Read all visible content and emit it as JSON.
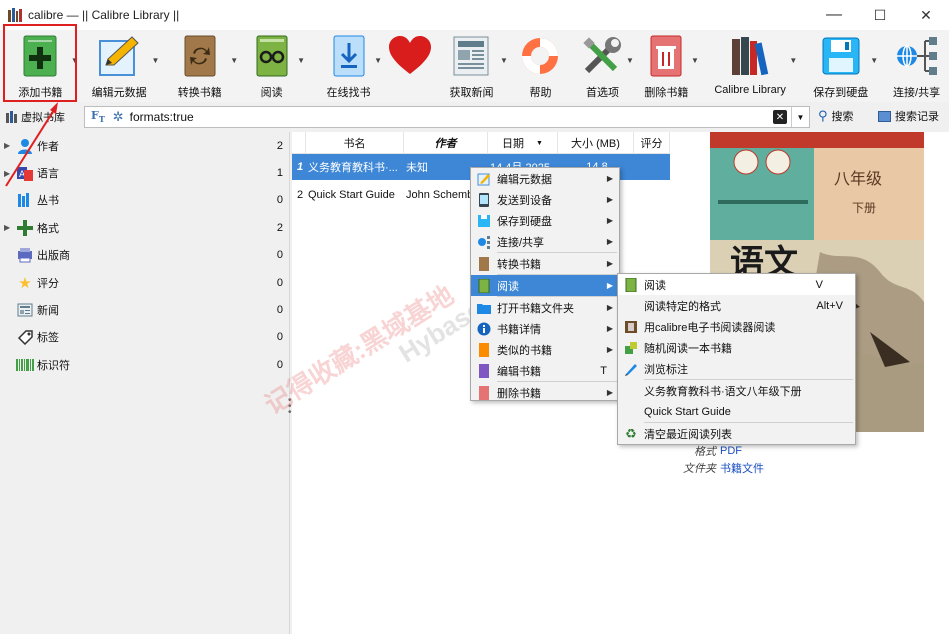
{
  "window": {
    "title": "calibre — || Calibre Library ||",
    "min": "—",
    "max": "☐",
    "close": "✕"
  },
  "toolbar": {
    "items": [
      {
        "label": "添加书籍",
        "icon": "add-book-icon"
      },
      {
        "label": "编辑元数据",
        "icon": "edit-metadata-icon"
      },
      {
        "label": "转换书籍",
        "icon": "convert-book-icon"
      },
      {
        "label": "阅读",
        "icon": "read-book-icon"
      },
      {
        "label": "在线找书",
        "icon": "find-online-icon"
      },
      {
        "label": "",
        "icon": "heart-icon"
      },
      {
        "label": "获取新闻",
        "icon": "fetch-news-icon"
      },
      {
        "label": "帮助",
        "icon": "help-lifebuoy-icon"
      },
      {
        "label": "首选项",
        "icon": "preferences-tools-icon"
      },
      {
        "label": "删除书籍",
        "icon": "delete-book-icon"
      },
      {
        "label": "Calibre Library",
        "icon": "library-icon"
      },
      {
        "label": "保存到硬盘",
        "icon": "save-disk-icon"
      },
      {
        "label": "连接/共享",
        "icon": "connect-share-icon"
      }
    ]
  },
  "search": {
    "virtual_library": "虚拟书库",
    "query": "formats:true",
    "search_label": "搜索",
    "history_label": "搜索记录"
  },
  "tag_browser": {
    "items": [
      {
        "label": "作者",
        "count": "2",
        "icon": "authors-icon"
      },
      {
        "label": "语言",
        "count": "1",
        "icon": "languages-icon"
      },
      {
        "label": "丛书",
        "count": "0",
        "icon": "series-icon"
      },
      {
        "label": "格式",
        "count": "2",
        "icon": "formats-icon"
      },
      {
        "label": "出版商",
        "count": "0",
        "icon": "publisher-icon"
      },
      {
        "label": "评分",
        "count": "0",
        "icon": "rating-star-icon"
      },
      {
        "label": "新闻",
        "count": "0",
        "icon": "news-icon"
      },
      {
        "label": "标签",
        "count": "0",
        "icon": "tags-icon"
      },
      {
        "label": "标识符",
        "count": "0",
        "icon": "identifiers-icon"
      }
    ]
  },
  "book_list": {
    "columns": [
      "书名",
      "作者",
      "日期",
      "大小 (MB)",
      "评分"
    ],
    "rows": [
      {
        "num": "1",
        "title": "义务教育教科书·...",
        "author": "未知",
        "date": "14 4月 2025",
        "size": "14.8"
      },
      {
        "num": "2",
        "title": "Quick Start Guide",
        "author": "John Schember",
        "date": "",
        "size": ""
      }
    ]
  },
  "context_menu": {
    "items": [
      {
        "label": "编辑元数据",
        "icon": "edit-metadata-icon",
        "submenu": true
      },
      {
        "label": "发送到设备",
        "icon": "send-device-icon",
        "submenu": true
      },
      {
        "label": "保存到硬盘",
        "icon": "save-disk-icon",
        "submenu": true
      },
      {
        "label": "连接/共享",
        "icon": "connect-share-icon",
        "submenu": true
      },
      {
        "label": "转换书籍",
        "icon": "convert-book-icon",
        "submenu": true
      },
      {
        "label": "阅读",
        "icon": "read-book-icon",
        "submenu": true
      },
      {
        "label": "打开书籍文件夹",
        "icon": "folder-icon",
        "submenu": true
      },
      {
        "label": "书籍详情",
        "icon": "info-icon",
        "submenu": true
      },
      {
        "label": "类似的书籍",
        "icon": "similar-books-icon",
        "submenu": true
      },
      {
        "label": "编辑书籍",
        "icon": "edit-book-icon",
        "shortcut": "T"
      },
      {
        "label": "删除书籍",
        "icon": "delete-book-icon",
        "submenu": true
      }
    ]
  },
  "read_submenu": {
    "items": [
      {
        "label": "阅读",
        "shortcut": "V",
        "icon": "read-book-icon"
      },
      {
        "label": "阅读特定的格式",
        "shortcut": "Alt+V",
        "icon": ""
      },
      {
        "label": "用calibre电子书阅读器阅读",
        "shortcut": "",
        "icon": "ebook-viewer-icon"
      },
      {
        "label": "随机阅读一本书籍",
        "shortcut": "",
        "icon": "random-icon"
      },
      {
        "label": "浏览标注",
        "shortcut": "",
        "icon": "annotations-icon"
      },
      {
        "label": "义务教育教科书·语文八年级下册",
        "shortcut": "",
        "icon": ""
      },
      {
        "label": "Quick Start Guide",
        "shortcut": "",
        "icon": ""
      },
      {
        "label": "清空最近阅读列表",
        "shortcut": "",
        "icon": "recycle-icon"
      }
    ]
  },
  "details": {
    "format_key": "格式",
    "format_val": "PDF",
    "path_key": "文件夹",
    "path_val": "书籍文件"
  },
  "cover": {
    "grade": "八年级",
    "volume": "下册",
    "subject": "语文"
  },
  "watermark": {
    "text": "记得收藏:黑域基地",
    "text2": "Hybase.com"
  }
}
